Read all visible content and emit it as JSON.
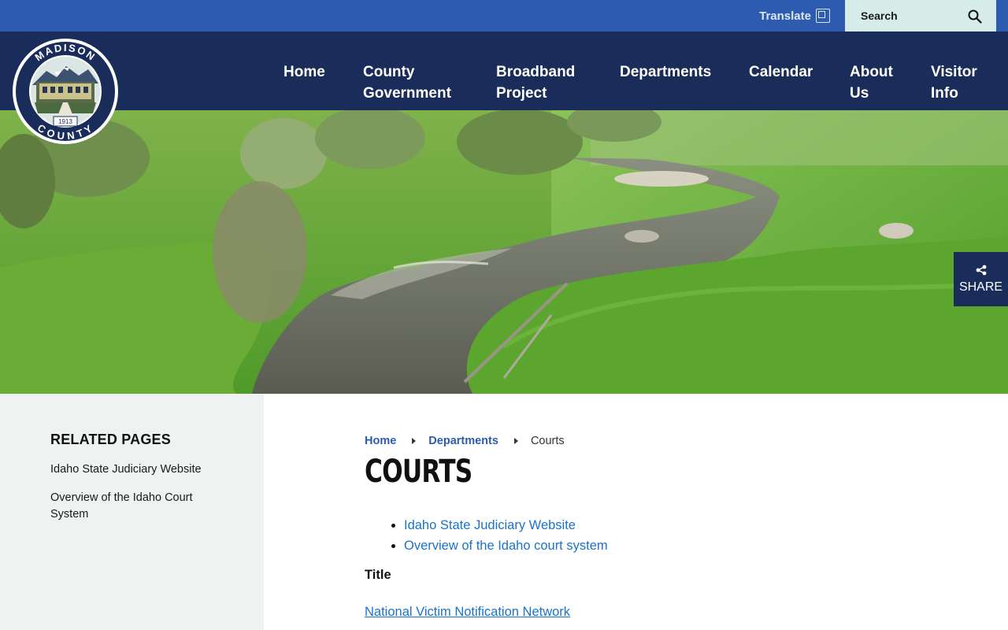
{
  "utility": {
    "translate_label": "Translate",
    "search_placeholder": "Search"
  },
  "logo": {
    "top_text": "MADISON",
    "bottom_text": "COUNTY",
    "year": "1913"
  },
  "nav": {
    "items": [
      {
        "line1": "Home",
        "line2": ""
      },
      {
        "line1": "County",
        "line2": "Government"
      },
      {
        "line1": "Broadband",
        "line2": "Project"
      },
      {
        "line1": "Departments",
        "line2": ""
      },
      {
        "line1": "Calendar",
        "line2": ""
      },
      {
        "line1": "About",
        "line2": "Us"
      },
      {
        "line1": "Visitor",
        "line2": "Info"
      }
    ]
  },
  "share": {
    "label": "SHARE"
  },
  "sidebar": {
    "title": "RELATED PAGES",
    "links": [
      "Idaho State Judiciary Website",
      "Overview of the Idaho Court System"
    ]
  },
  "breadcrumb": {
    "home": "Home",
    "departments": "Departments",
    "current": "Courts"
  },
  "content": {
    "title": "COURTS",
    "links": [
      "Idaho State Judiciary Website",
      "Overview of the Idaho court system"
    ],
    "table_header": "Title",
    "table_rows": [
      "National Victim Notification Network"
    ]
  },
  "colors": {
    "utility_bar": "#2d5bb0",
    "header": "#1a2d5a",
    "search_bg": "#d6ece9",
    "sidebar_bg": "#eef3f2",
    "link": "#1a73c9"
  }
}
